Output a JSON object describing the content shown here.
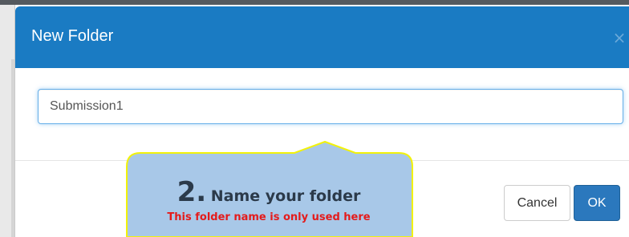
{
  "dialog": {
    "title": "New Folder",
    "close_label": "×",
    "folder_name_value": "Submission1",
    "cancel_label": "Cancel",
    "ok_label": "OK"
  },
  "callout": {
    "step_number": "2.",
    "step_label": "Name your folder",
    "note": "This folder name is only used here"
  },
  "colors": {
    "header": "#1a7bc3",
    "primary_button": "#2b78bd",
    "callout_fill": "#a8c8e8",
    "callout_border": "#f2f20a",
    "note_text": "#e41b1b"
  },
  "icons": {
    "close": "close-icon"
  }
}
